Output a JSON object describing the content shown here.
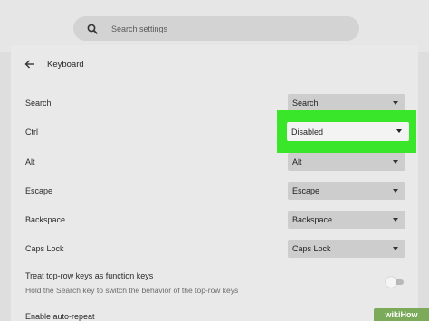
{
  "search": {
    "placeholder": "Search settings",
    "icon": "search-icon"
  },
  "header": {
    "title": "Keyboard",
    "back_icon": "arrow-left-icon"
  },
  "rows": [
    {
      "label": "Search",
      "value": "Search"
    },
    {
      "label": "Ctrl",
      "value": "Disabled"
    },
    {
      "label": "Alt",
      "value": "Alt"
    },
    {
      "label": "Escape",
      "value": "Escape"
    },
    {
      "label": "Backspace",
      "value": "Backspace"
    },
    {
      "label": "Caps Lock",
      "value": "Caps Lock"
    }
  ],
  "function_keys": {
    "title": "Treat top-row keys as function keys",
    "description": "Hold the Search key to switch the behavior of the top-row keys",
    "enabled": false
  },
  "auto_repeat": {
    "title": "Enable auto-repeat"
  },
  "watermark": "wikiHow",
  "colors": {
    "highlight": "#39e62a",
    "background": "#dedede"
  }
}
